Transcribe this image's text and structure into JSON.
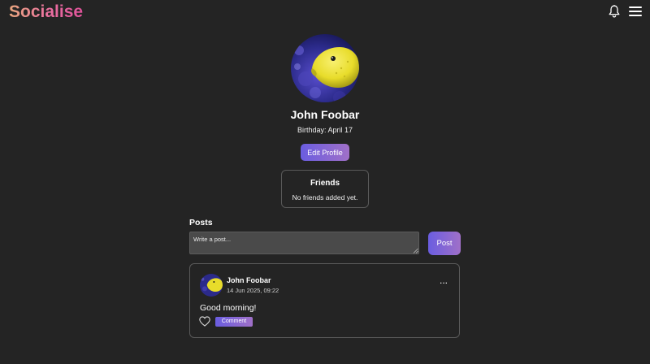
{
  "header": {
    "logo": "Socialise",
    "icons": [
      "bell-icon",
      "hamburger-menu-icon"
    ]
  },
  "profile": {
    "name": "John Foobar",
    "birthday": "Birthday: April 17",
    "edit_label": "Edit Profile",
    "avatar": "yellow-pufferfish-photo"
  },
  "friends": {
    "title": "Friends",
    "empty_text": "No friends added yet."
  },
  "posts": {
    "title": "Posts",
    "input_placeholder": "Write a post...",
    "post_label": "Post",
    "items": [
      {
        "author": "John Foobar",
        "date": "14 Jun 2025, 09:22",
        "menu": "...",
        "text": "Good morning!",
        "comment_label": "Comment"
      }
    ]
  },
  "colors": {
    "background": "#242424",
    "accent_start": "#6a5de0",
    "accent_end": "#a070c8",
    "logo_start": "#e9a77e",
    "logo_end": "#e0529a",
    "border": "#5a5a5a"
  }
}
